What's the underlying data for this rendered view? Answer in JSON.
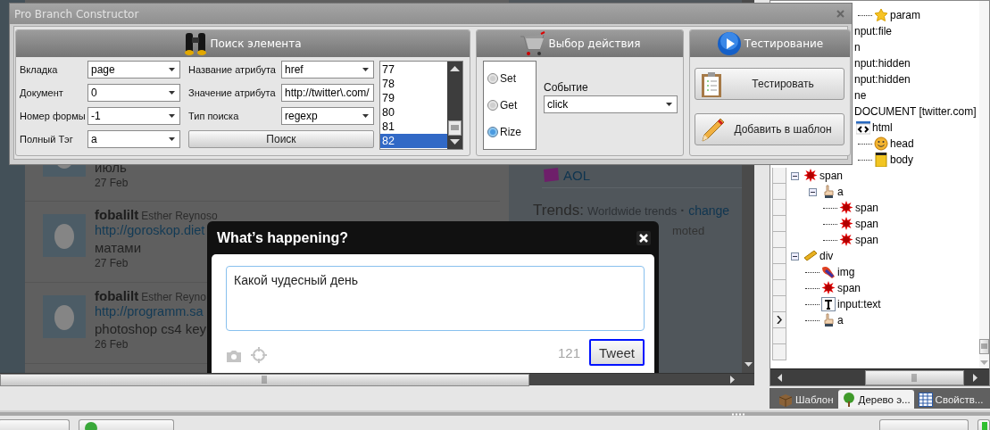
{
  "dialog": {
    "title": "Pro Branch Constructor",
    "search_panel": {
      "title": "Поиск элемента",
      "fields": [
        {
          "label": "Вкладка",
          "value": "page"
        },
        {
          "label": "Документ",
          "value": "0"
        },
        {
          "label": "Номер формы",
          "value": "-1"
        },
        {
          "label": "Полный Тэг",
          "value": "a"
        }
      ],
      "attribute_fields": [
        {
          "label": "Название атрибута",
          "value": "href",
          "kind": "combo"
        },
        {
          "label": "Значение атрибута",
          "value": "http://twitter\\.com/",
          "kind": "text"
        },
        {
          "label": "Тип поиска",
          "value": "regexp",
          "kind": "combo"
        }
      ],
      "search_button": "Поиск",
      "results": [
        {
          "label": "77",
          "selected": false
        },
        {
          "label": "78",
          "selected": false
        },
        {
          "label": "79",
          "selected": false
        },
        {
          "label": "80",
          "selected": false
        },
        {
          "label": "81",
          "selected": false
        },
        {
          "label": "82",
          "selected": true
        }
      ]
    },
    "action_panel": {
      "title": "Выбор действия",
      "modes": [
        {
          "label": "Set",
          "selected": false
        },
        {
          "label": "Get",
          "selected": false
        },
        {
          "label": "Rize",
          "selected": true
        }
      ],
      "event": {
        "label": "Событие",
        "value": "click"
      }
    },
    "test_panel": {
      "title": "Тестирование",
      "buttons": [
        {
          "label": "Тестировать",
          "kind": "clipboard"
        },
        {
          "label": "Добавить в шаблон",
          "kind": "pencil"
        }
      ]
    }
  },
  "browser": {
    "feed": [
      {
        "kind": "partial",
        "text": "июль",
        "date": "27 Feb"
      },
      {
        "kind": "tweet",
        "user": "fobalilt",
        "name": "Esther Reynoso",
        "link": "http://goroskop.diet",
        "text": "матами",
        "date": "27 Feb"
      },
      {
        "kind": "tweet",
        "user": "fobalilt",
        "name": "Esther Reyno",
        "link": "http://programm.sa",
        "text": "photoshop cs4 key",
        "date": "26 Feb"
      }
    ],
    "sidebar": {
      "account": "AOL",
      "trends_title": "Trends:",
      "trends_scope": "Worldwide trends",
      "separator": "·",
      "change_link": "change",
      "promoted_fragment": "moted"
    },
    "modal": {
      "title": "What’s happening?",
      "text": "Какой чудесный день",
      "remaining": "121",
      "button": "Tweet",
      "button_focused": true
    }
  },
  "tree": {
    "upper_rows": [
      {
        "kind": "param",
        "label": "param"
      },
      {
        "kind": "clipped",
        "label": "nput:file"
      },
      {
        "kind": "clipped",
        "label": "n"
      },
      {
        "kind": "clipped",
        "label": "nput:hidden"
      },
      {
        "kind": "clipped",
        "label": "nput:hidden"
      },
      {
        "kind": "clipped",
        "label": "ne"
      },
      {
        "kind": "clipped",
        "label": "DOCUMENT [twitter.com]",
        "children": [
          {
            "kind": "html",
            "label": "html",
            "children": [
              {
                "kind": "head",
                "label": "head"
              },
              {
                "kind": "body",
                "label": "body"
              }
            ]
          }
        ]
      }
    ],
    "rows": [
      {
        "kind": "span",
        "label": "span",
        "expanded": true,
        "current": false,
        "children": [
          {
            "kind": "link",
            "label": "a",
            "expanded": true,
            "current": false,
            "children": [
              {
                "kind": "span",
                "label": "span",
                "current": false
              },
              {
                "kind": "span",
                "label": "span",
                "current": false
              },
              {
                "kind": "span",
                "label": "span",
                "current": false
              }
            ]
          }
        ]
      },
      {
        "kind": "div",
        "label": "div",
        "expanded": true,
        "current": false,
        "children": [
          {
            "kind": "img",
            "label": "img",
            "current": false
          },
          {
            "kind": "span",
            "label": "span",
            "current": false
          },
          {
            "kind": "text-input",
            "label": "input:text",
            "current": false
          },
          {
            "kind": "link",
            "label": "a",
            "current": true
          }
        ]
      }
    ]
  },
  "tree_tabs": [
    {
      "kind": "box",
      "label": "Шаблон",
      "selected": false
    },
    {
      "kind": "tree",
      "label": "Дерево э...",
      "selected": true
    },
    {
      "kind": "grid",
      "label": "Свойств...",
      "selected": false
    }
  ]
}
